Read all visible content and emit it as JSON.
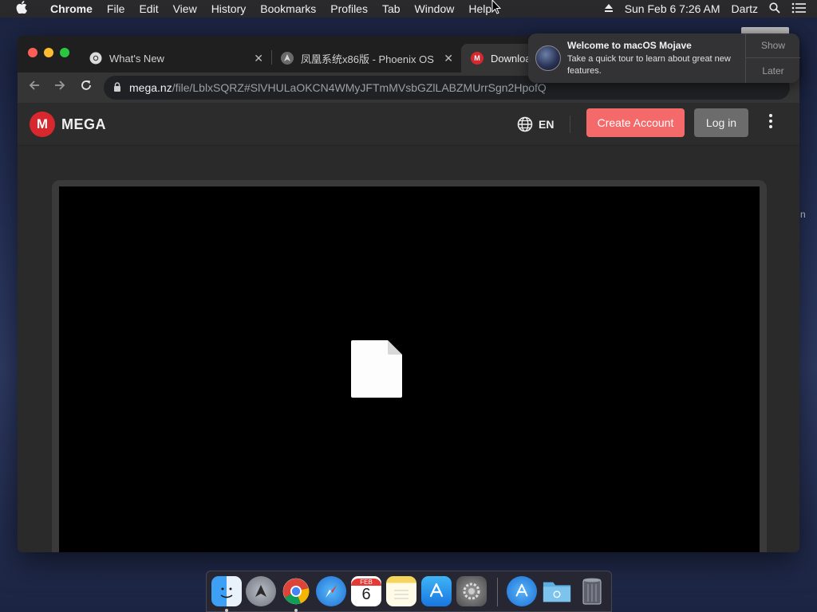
{
  "menubar": {
    "apple_icon": "apple-icon",
    "app_name": "Chrome",
    "items": [
      "File",
      "Edit",
      "View",
      "History",
      "Bookmarks",
      "Profiles",
      "Tab",
      "Window",
      "Help"
    ],
    "datetime": "Sun Feb 6  7:26 AM",
    "user": "Dartz",
    "right_icons": [
      "eject-icon",
      "spotlight-search-icon",
      "control-list-icon"
    ]
  },
  "browser": {
    "tabs": [
      {
        "title": "What's New",
        "favicon": "chrome-icon"
      },
      {
        "title": "凤凰系统x86版 - Phoenix OS",
        "favicon": "phoenix-os-icon"
      },
      {
        "title": "Downloa",
        "favicon": "mega-favicon"
      }
    ],
    "url": {
      "host": "mega.nz",
      "path": "/file/LblxSQRZ#SlVHULaOKCN4WMyJFTmMVsbGZlLABZMUrrSgn2HpofQ"
    }
  },
  "mega": {
    "brand": "MEGA",
    "logo_letter": "M",
    "language": "EN",
    "create_account_label": "Create Account",
    "login_label": "Log in",
    "colors": {
      "brand_red": "#d9272e",
      "create_account_bg": "#f46a6a",
      "login_bg": "#6c6c6c"
    }
  },
  "notification": {
    "title": "Welcome to macOS Mojave",
    "body": "Take a quick tour to learn about great new features.",
    "show_label": "Show",
    "later_label": "Later"
  },
  "desktop": {
    "edge_letter": "n"
  },
  "dock": {
    "apps": [
      "finder",
      "launchpad",
      "chrome",
      "safari",
      "calendar",
      "notes",
      "app-store",
      "system-preferences",
      "app-store-downloads",
      "folder",
      "trash"
    ],
    "calendar_month": "FEB",
    "calendar_day": "6"
  }
}
